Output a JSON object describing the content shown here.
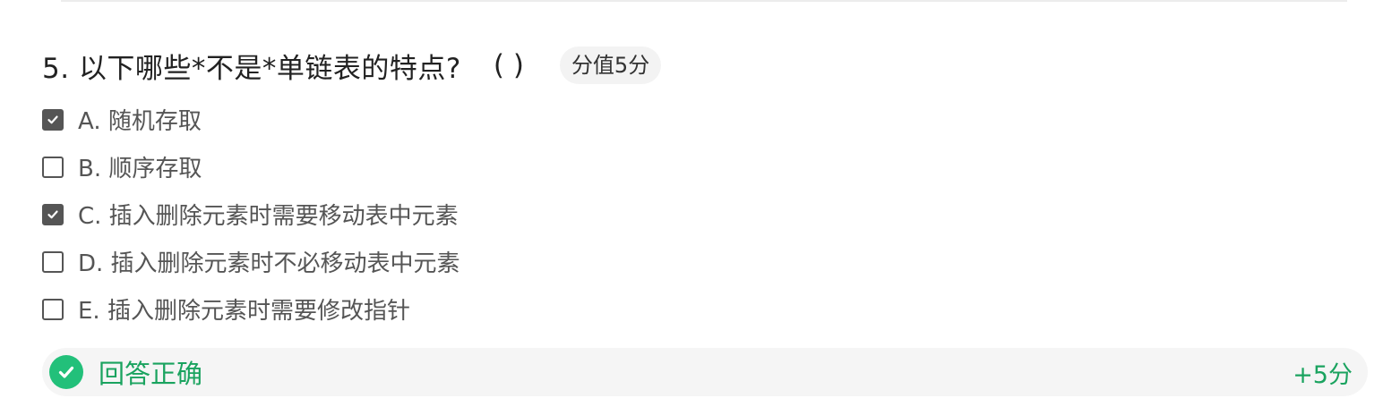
{
  "question": {
    "title": "5. 以下哪些*不是*单链表的特点?",
    "paren": "( )",
    "score_badge": "分值5分"
  },
  "options": [
    {
      "label": "A. 随机存取",
      "checked": true
    },
    {
      "label": "B. 顺序存取",
      "checked": false
    },
    {
      "label": "C. 插入删除元素时需要移动表中元素",
      "checked": true
    },
    {
      "label": "D. 插入删除元素时不必移动表中元素",
      "checked": false
    },
    {
      "label": "E. 插入删除元素时需要修改指针",
      "checked": false
    }
  ],
  "result": {
    "icon": "check-circle-icon",
    "status_text": "回答正确",
    "points": "+5分"
  },
  "colors": {
    "correct_green": "#1aa35f",
    "icon_green": "#22c07a",
    "checkbox_dark": "#555555",
    "badge_bg": "#f3f3f3",
    "result_bg": "#f5f5f5"
  }
}
